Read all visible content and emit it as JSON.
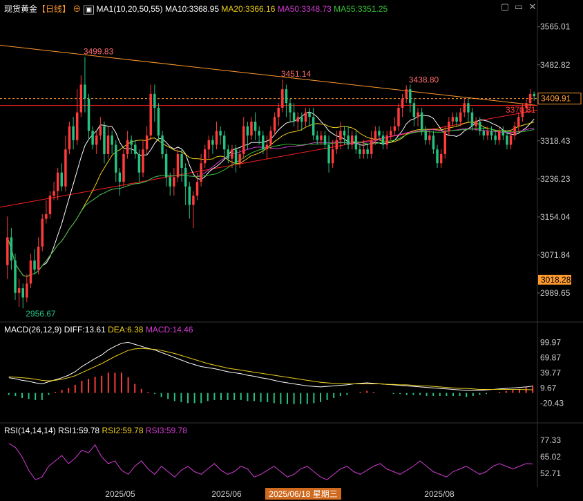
{
  "header": {
    "symbol": "现货黄金",
    "period": "【日线】",
    "ma_params": "MA1(10,20,50,55)",
    "ma10": "MA10:3368.95",
    "ma20": "MA20:3366.16",
    "ma50": "MA50:3348.73",
    "ma55": "MA55:3351.25"
  },
  "macd_header": {
    "params": "MACD(26,12,9)",
    "diff": "DIFF:13.61",
    "dea": "DEA:6.38",
    "macd": "MACD:14.46"
  },
  "rsi_header": {
    "params": "RSI(14,14,14)",
    "rsi1": "RSI1:59.78",
    "rsi2": "RSI2:59.78",
    "rsi3": "RSI3:59.78"
  },
  "colors": {
    "up": "#ff3b3b",
    "down": "#26c281",
    "ma10": "#ffffff",
    "ma20": "#f2d21b",
    "ma50": "#d23cd2",
    "ma55": "#35c235",
    "trend_upper": "#ff9a2e",
    "trend_lower": "#ff2020"
  },
  "chart_data": [
    {
      "type": "candlestick",
      "title": "现货黄金 日线",
      "ylim": [
        2930,
        3590
      ],
      "y_ticks": [
        "3565.01",
        "3482.82",
        "3318.43",
        "3236.23",
        "3154.04",
        "3071.84",
        "2989.65"
      ],
      "x_ticks": [
        "2025/05",
        "2025/06",
        "2025/08"
      ],
      "current_price": "3409.91",
      "price_markers": [
        "3018.28"
      ],
      "annotations": [
        "3499.83",
        "3451.14",
        "3438.80",
        "2956.67",
        "3370.81"
      ],
      "cursor_date": "2025/06/18 星期三",
      "candles": [
        [
          3050,
          3110,
          3020,
          3155
        ],
        [
          3110,
          3060,
          3040,
          3130
        ],
        [
          3060,
          2990,
          2975,
          3075
        ],
        [
          2990,
          3000,
          2960,
          3020
        ],
        [
          3000,
          2980,
          2956.67,
          3010
        ],
        [
          2980,
          3010,
          2970,
          3030
        ],
        [
          3010,
          3060,
          3000,
          3075
        ],
        [
          3060,
          3040,
          3030,
          3085
        ],
        [
          3040,
          3090,
          3030,
          3110
        ],
        [
          3090,
          3150,
          3080,
          3160
        ],
        [
          3150,
          3160,
          3140,
          3190
        ],
        [
          3160,
          3200,
          3150,
          3210
        ],
        [
          3200,
          3210,
          3190,
          3230
        ],
        [
          3210,
          3250,
          3190,
          3260
        ],
        [
          3250,
          3220,
          3210,
          3270
        ],
        [
          3220,
          3300,
          3210,
          3330
        ],
        [
          3300,
          3350,
          3290,
          3360
        ],
        [
          3350,
          3320,
          3300,
          3370
        ],
        [
          3320,
          3380,
          3310,
          3430
        ],
        [
          3380,
          3440,
          3370,
          3460
        ],
        [
          3440,
          3410,
          3380,
          3499.83
        ],
        [
          3410,
          3340,
          3320,
          3420
        ],
        [
          3340,
          3310,
          3300,
          3350
        ],
        [
          3310,
          3330,
          3290,
          3340
        ],
        [
          3330,
          3350,
          3320,
          3370
        ],
        [
          3350,
          3290,
          3270,
          3360
        ],
        [
          3290,
          3330,
          3280,
          3350
        ],
        [
          3330,
          3310,
          3290,
          3340
        ],
        [
          3310,
          3250,
          3230,
          3320
        ],
        [
          3250,
          3230,
          3200,
          3260
        ],
        [
          3230,
          3290,
          3220,
          3300
        ],
        [
          3290,
          3320,
          3280,
          3340
        ],
        [
          3320,
          3310,
          3290,
          3330
        ],
        [
          3310,
          3290,
          3280,
          3320
        ],
        [
          3290,
          3250,
          3230,
          3300
        ],
        [
          3250,
          3300,
          3240,
          3320
        ],
        [
          3300,
          3330,
          3290,
          3350
        ],
        [
          3330,
          3420,
          3320,
          3440
        ],
        [
          3420,
          3390,
          3360,
          3440
        ],
        [
          3390,
          3330,
          3320,
          3400
        ],
        [
          3330,
          3290,
          3280,
          3340
        ],
        [
          3290,
          3240,
          3220,
          3300
        ],
        [
          3240,
          3220,
          3200,
          3250
        ],
        [
          3220,
          3240,
          3200,
          3260
        ],
        [
          3240,
          3290,
          3230,
          3300
        ],
        [
          3290,
          3260,
          3230,
          3300
        ],
        [
          3260,
          3220,
          3180,
          3270
        ],
        [
          3220,
          3180,
          3150,
          3230
        ],
        [
          3180,
          3200,
          3130,
          3210
        ],
        [
          3200,
          3230,
          3190,
          3250
        ],
        [
          3230,
          3270,
          3220,
          3290
        ],
        [
          3270,
          3300,
          3260,
          3310
        ],
        [
          3300,
          3320,
          3280,
          3330
        ],
        [
          3320,
          3310,
          3290,
          3330
        ],
        [
          3310,
          3340,
          3300,
          3360
        ],
        [
          3340,
          3330,
          3310,
          3350
        ],
        [
          3330,
          3300,
          3280,
          3340
        ],
        [
          3300,
          3280,
          3270,
          3310
        ],
        [
          3280,
          3300,
          3260,
          3310
        ],
        [
          3300,
          3270,
          3250,
          3310
        ],
        [
          3270,
          3290,
          3260,
          3300
        ],
        [
          3290,
          3350,
          3280,
          3370
        ],
        [
          3350,
          3330,
          3300,
          3360
        ],
        [
          3330,
          3360,
          3320,
          3370
        ],
        [
          3360,
          3340,
          3320,
          3380
        ],
        [
          3340,
          3330,
          3310,
          3350
        ],
        [
          3330,
          3300,
          3290,
          3340
        ],
        [
          3300,
          3310,
          3280,
          3330
        ],
        [
          3310,
          3340,
          3300,
          3350
        ],
        [
          3340,
          3370,
          3330,
          3380
        ],
        [
          3370,
          3390,
          3350,
          3400
        ],
        [
          3390,
          3430,
          3380,
          3451.14
        ],
        [
          3430,
          3400,
          3370,
          3440
        ],
        [
          3400,
          3380,
          3360,
          3410
        ],
        [
          3380,
          3360,
          3350,
          3400
        ],
        [
          3360,
          3370,
          3340,
          3380
        ],
        [
          3370,
          3360,
          3340,
          3380
        ],
        [
          3360,
          3380,
          3350,
          3390
        ],
        [
          3380,
          3370,
          3350,
          3390
        ],
        [
          3370,
          3330,
          3320,
          3390
        ],
        [
          3330,
          3320,
          3310,
          3340
        ],
        [
          3320,
          3330,
          3310,
          3340
        ],
        [
          3330,
          3310,
          3300,
          3340
        ],
        [
          3310,
          3270,
          3250,
          3330
        ],
        [
          3270,
          3300,
          3260,
          3320
        ],
        [
          3300,
          3320,
          3290,
          3340
        ],
        [
          3320,
          3340,
          3300,
          3360
        ],
        [
          3340,
          3330,
          3310,
          3350
        ],
        [
          3330,
          3310,
          3300,
          3350
        ],
        [
          3310,
          3330,
          3300,
          3340
        ],
        [
          3330,
          3300,
          3290,
          3340
        ],
        [
          3300,
          3290,
          3280,
          3310
        ],
        [
          3290,
          3300,
          3280,
          3320
        ],
        [
          3300,
          3290,
          3280,
          3310
        ],
        [
          3290,
          3320,
          3280,
          3340
        ],
        [
          3320,
          3340,
          3310,
          3350
        ],
        [
          3340,
          3330,
          3320,
          3350
        ],
        [
          3330,
          3310,
          3300,
          3340
        ],
        [
          3310,
          3330,
          3300,
          3340
        ],
        [
          3330,
          3340,
          3320,
          3350
        ],
        [
          3340,
          3350,
          3330,
          3370
        ],
        [
          3350,
          3390,
          3340,
          3400
        ],
        [
          3390,
          3410,
          3370,
          3420
        ],
        [
          3410,
          3430,
          3400,
          3438.8
        ],
        [
          3430,
          3400,
          3380,
          3440
        ],
        [
          3400,
          3370,
          3350,
          3410
        ],
        [
          3370,
          3380,
          3350,
          3390
        ],
        [
          3380,
          3340,
          3330,
          3390
        ],
        [
          3340,
          3320,
          3310,
          3350
        ],
        [
          3320,
          3330,
          3310,
          3340
        ],
        [
          3330,
          3300,
          3290,
          3340
        ],
        [
          3300,
          3270,
          3260,
          3310
        ],
        [
          3270,
          3290,
          3260,
          3300
        ],
        [
          3290,
          3340,
          3280,
          3350
        ],
        [
          3340,
          3360,
          3330,
          3370
        ],
        [
          3360,
          3370,
          3350,
          3380
        ],
        [
          3370,
          3360,
          3350,
          3380
        ],
        [
          3360,
          3380,
          3350,
          3390
        ],
        [
          3380,
          3400,
          3370,
          3410
        ],
        [
          3400,
          3380,
          3360,
          3410
        ],
        [
          3380,
          3350,
          3340,
          3390
        ],
        [
          3350,
          3360,
          3340,
          3370
        ],
        [
          3360,
          3340,
          3330,
          3370
        ],
        [
          3340,
          3330,
          3320,
          3350
        ],
        [
          3330,
          3340,
          3320,
          3350
        ],
        [
          3340,
          3330,
          3320,
          3350
        ],
        [
          3330,
          3320,
          3310,
          3340
        ],
        [
          3320,
          3340,
          3310,
          3350
        ],
        [
          3340,
          3330,
          3320,
          3350
        ],
        [
          3330,
          3310,
          3300,
          3340
        ],
        [
          3310,
          3330,
          3300,
          3340
        ],
        [
          3330,
          3350,
          3320,
          3360
        ],
        [
          3350,
          3370,
          3340,
          3380
        ],
        [
          3370,
          3390,
          3360,
          3400
        ],
        [
          3390,
          3400,
          3380,
          3410
        ],
        [
          3400,
          3420,
          3390,
          3430
        ],
        [
          3420,
          3415,
          3405,
          3425
        ]
      ]
    },
    {
      "type": "line",
      "title": "MACD(26,12,9)",
      "ylim": [
        -40,
        110
      ],
      "y_ticks": [
        "99.97",
        "69.87",
        "39.77",
        "9.67",
        "-20.43"
      ],
      "series": [
        {
          "name": "DIFF",
          "values": [
            30,
            28,
            25,
            23,
            20,
            18,
            22,
            26,
            30,
            35,
            42,
            52,
            60,
            68,
            75,
            85,
            92,
            98,
            99.97,
            96,
            92,
            88,
            85,
            80,
            75,
            70,
            65,
            60,
            56,
            52,
            50,
            48,
            45,
            42,
            40,
            38,
            35,
            33,
            30,
            28,
            25,
            22,
            20,
            18,
            16,
            14,
            13,
            12,
            13,
            14,
            15,
            16,
            18,
            19,
            20,
            19,
            18,
            17,
            16,
            15,
            14,
            13,
            12,
            11,
            10,
            9,
            8,
            7,
            6,
            5,
            5,
            5,
            6,
            7,
            8,
            9,
            10,
            11,
            12,
            13.61
          ]
        },
        {
          "name": "DEA",
          "values": [
            32,
            31,
            30,
            29,
            27,
            25,
            24,
            25,
            27,
            30,
            34,
            40,
            46,
            52,
            58,
            65,
            72,
            78,
            84,
            87,
            88,
            87,
            86,
            84,
            81,
            78,
            74,
            70,
            66,
            62,
            58,
            55,
            52,
            49,
            47,
            45,
            43,
            41,
            39,
            37,
            35,
            33,
            31,
            29,
            27,
            25,
            23,
            21,
            20,
            19,
            18,
            18,
            18,
            18,
            18,
            18,
            18,
            17,
            17,
            16,
            16,
            15,
            14,
            14,
            13,
            12,
            11,
            10,
            9,
            9,
            8,
            7,
            7,
            7,
            7,
            7,
            7,
            7,
            6.5,
            6.38
          ]
        },
        {
          "name": "MACD",
          "values": [
            -4,
            -6,
            -10,
            -12,
            -14,
            -14,
            -4,
            2,
            6,
            10,
            16,
            24,
            28,
            32,
            34,
            40,
            40,
            40,
            31,
            18,
            8,
            2,
            -2,
            -8,
            -12,
            -16,
            -18,
            -20,
            -20,
            -20,
            -16,
            -14,
            -14,
            -14,
            -14,
            -14,
            -16,
            -16,
            -18,
            -18,
            -20,
            -22,
            -22,
            -22,
            -22,
            -22,
            -20,
            -18,
            -14,
            -10,
            -6,
            -4,
            0,
            2,
            4,
            2,
            0,
            0,
            -2,
            -2,
            -4,
            -4,
            -4,
            -6,
            -6,
            -6,
            -6,
            -6,
            -6,
            -8,
            -6,
            -4,
            -2,
            0,
            2,
            4,
            6,
            8,
            11,
            14.46
          ]
        }
      ]
    },
    {
      "type": "line",
      "title": "RSI(14,14,14)",
      "ylim": [
        45,
        80
      ],
      "y_ticks": [
        "77.33",
        "65.02",
        "52.71"
      ],
      "series": [
        {
          "name": "RSI1",
          "values": [
            75,
            72,
            65,
            55,
            48,
            50,
            58,
            62,
            66,
            60,
            64,
            70,
            68,
            74,
            65,
            60,
            62,
            55,
            52,
            58,
            62,
            56,
            52,
            58,
            54,
            50,
            55,
            58,
            54,
            52,
            56,
            60,
            55,
            52,
            54,
            58,
            56,
            50,
            52,
            55,
            58,
            54,
            50,
            52,
            56,
            58,
            54,
            50,
            48,
            52,
            56,
            58,
            54,
            52,
            55,
            58,
            60,
            56,
            54,
            52,
            55,
            58,
            62,
            58,
            54,
            52,
            50,
            54,
            56,
            58,
            55,
            52,
            54,
            58,
            60,
            58,
            56,
            58,
            60,
            59.78
          ]
        }
      ]
    }
  ]
}
